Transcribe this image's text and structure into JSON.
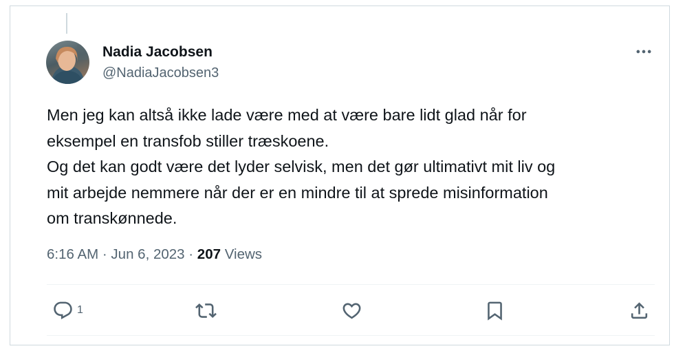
{
  "tweet": {
    "author": {
      "name": "Nadia Jacobsen",
      "handle": "@NadiaJacobsen3",
      "avatar_icon": "user-avatar-photo"
    },
    "text_lines": [
      "Men jeg kan altså ikke lade være med at være bare lidt glad når for",
      "eksempel en transfob stiller træskoene.",
      "Og det kan godt være det lyder selvisk, men det gør ultimativt mit liv og",
      "mit arbejde nemmere når der er en mindre til at sprede misinformation",
      "om transkønnede."
    ],
    "timestamp": "6:16 AM · Jun 6, 2023",
    "separator": " · ",
    "views_count": "207",
    "views_label": " Views"
  },
  "actions": {
    "reply_count": "1",
    "icons": [
      "reply-icon",
      "retweet-icon",
      "like-icon",
      "bookmark-icon",
      "share-icon"
    ]
  },
  "colors": {
    "text": "#0f1419",
    "secondary": "#536471",
    "border": "#cfd9de"
  }
}
